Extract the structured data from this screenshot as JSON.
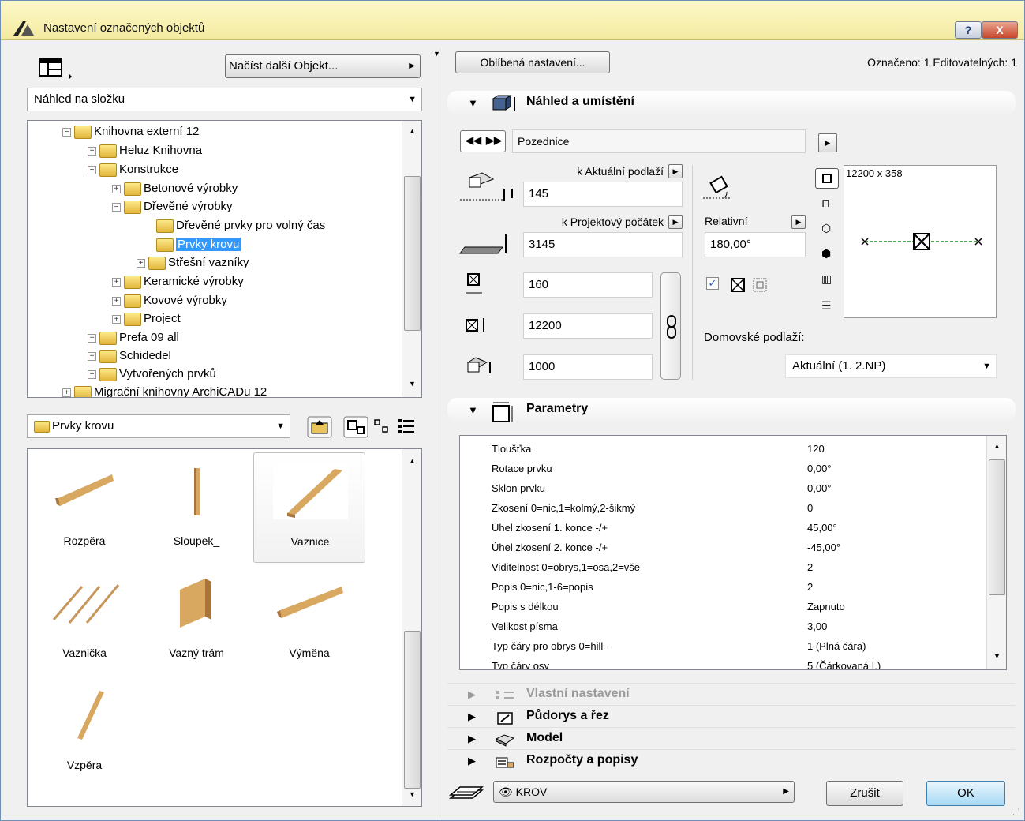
{
  "window": {
    "title": "Nastavení označených objektů",
    "help_label": "?",
    "close_label": "X"
  },
  "left": {
    "load_button": "Načíst další Objekt...",
    "view_mode": "Náhled na složku",
    "tree": [
      {
        "label": "Knihovna externí 12",
        "exp": "−"
      },
      {
        "label": "Heluz Knihovna",
        "exp": "+"
      },
      {
        "label": "Konstrukce",
        "exp": "−"
      },
      {
        "label": "Betonové výrobky",
        "exp": "+"
      },
      {
        "label": "Dřevěné výrobky",
        "exp": "−"
      },
      {
        "label": "Dřevěné prvky pro volný čas",
        "exp": ""
      },
      {
        "label": "Prvky krovu",
        "exp": ""
      },
      {
        "label": "Střešní vazníky",
        "exp": "+"
      },
      {
        "label": "Keramické výrobky",
        "exp": "+"
      },
      {
        "label": "Kovové výrobky",
        "exp": "+"
      },
      {
        "label": "Project",
        "exp": "+"
      },
      {
        "label": "Prefa 09 all",
        "exp": "+"
      },
      {
        "label": "Schidedel",
        "exp": "+"
      },
      {
        "label": "Vytvořených prvků",
        "exp": "+"
      },
      {
        "label": "Migrační knihovny ArchiCADu 12",
        "exp": "+"
      }
    ],
    "folder_combo": "Prvky krovu",
    "items": [
      {
        "label": "Rozpěra"
      },
      {
        "label": "Sloupek_"
      },
      {
        "label": "Vaznice"
      },
      {
        "label": "Vaznička"
      },
      {
        "label": "Vazný trám"
      },
      {
        "label": "Výměna"
      },
      {
        "label": "Vzpěra"
      }
    ]
  },
  "right": {
    "favorites_button": "Oblíbená nastavení...",
    "selection_info": "Označeno: 1 Editovatelných: 1",
    "preview_section": {
      "title": "Náhled a umístění",
      "object_name": "Pozednice",
      "to_current_story_label": "k Aktuální podlaží",
      "elevation_value": "145",
      "to_project_zero_label": "k Projektový počátek",
      "project_elevation_value": "3145",
      "width_value": "160",
      "length_value": "12200",
      "height_value": "1000",
      "relative_label": "Relativní",
      "angle_value": "180,00°",
      "preview_dim": "12200 x 358",
      "home_story_label": "Domovské podlaží:",
      "home_story_value": "Aktuální (1. 2.NP)"
    },
    "params_section": {
      "title": "Parametry",
      "rows": [
        {
          "name": "Tloušťka",
          "value": "120"
        },
        {
          "name": "Rotace prvku",
          "value": "0,00°"
        },
        {
          "name": "Sklon prvku",
          "value": "0,00°"
        },
        {
          "name": "Zkosení 0=nic,1=kolmý,2-šikmý",
          "value": "0"
        },
        {
          "name": "Úhel zkosení 1. konce -/+",
          "value": "45,00°"
        },
        {
          "name": "Úhel zkosení 2. konce -/+",
          "value": "-45,00°"
        },
        {
          "name": "Viditelnost 0=obrys,1=osa,2=vše",
          "value": "2"
        },
        {
          "name": "Popis 0=nic,1-6=popis",
          "value": "2"
        },
        {
          "name": "Popis s délkou",
          "value": "Zapnuto"
        },
        {
          "name": "Velikost písma",
          "value": "3,00"
        },
        {
          "name": "Typ čáry pro obrys 0=hill--",
          "value": "1 (Plná čára)"
        },
        {
          "name": "Typ čáry osy",
          "value": "5 (Čárkovaná I.)"
        }
      ]
    },
    "collapsed_sections": [
      {
        "title": "Vlastní nastavení",
        "disabled": true
      },
      {
        "title": "Půdorys a řez",
        "disabled": false
      },
      {
        "title": "Model",
        "disabled": false
      },
      {
        "title": "Rozpočty a popisy",
        "disabled": false
      }
    ],
    "layer_value": "KROV",
    "cancel_button": "Zrušit",
    "ok_button": "OK"
  },
  "colors": {
    "title_bar": "#fdf9c9",
    "selection": "#3399ff",
    "wood": "#d9a860"
  }
}
